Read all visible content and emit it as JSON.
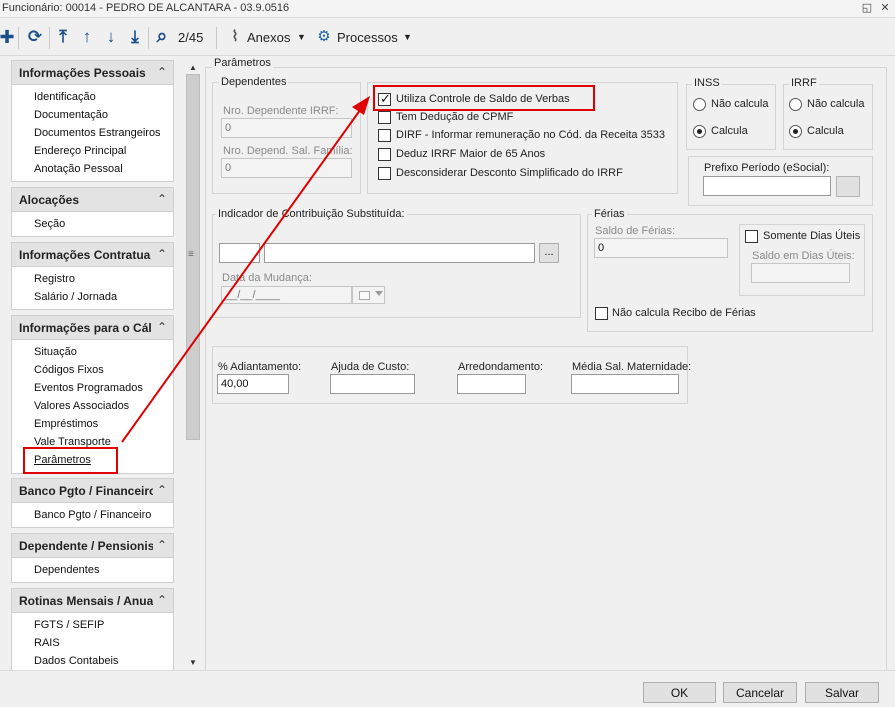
{
  "window": {
    "title": "Funcionário: 00014 - PEDRO DE ALCANTARA - 03.9.0516",
    "restore_glyph": "◱",
    "close_glyph": "✕"
  },
  "toolbar": {
    "add_icon": "plus-icon",
    "refresh_icon": "refresh-icon",
    "first_icon": "arrow-to-top-icon",
    "prev_icon": "arrow-up-icon",
    "next_icon": "arrow-down-icon",
    "last_icon": "arrow-to-bottom-icon",
    "search_icon": "search-icon",
    "record_position": "2/45",
    "attachments_label": "Anexos",
    "processes_label": "Processos",
    "glyphs": {
      "add": "✚",
      "refresh": "⟳",
      "first": "⤒",
      "prev": "↑",
      "next": "↓",
      "last": "⤓",
      "search": "⌕",
      "clip": "⌇",
      "gear": "⚙",
      "caret": "▼"
    }
  },
  "sidebar": {
    "collapse_glyph": "⌃",
    "sections": [
      {
        "title": "Informações Pessoais",
        "items": [
          "Identificação",
          "Documentação",
          "Documentos Estrangeiros",
          "Endereço Principal",
          "Anotação Pessoal"
        ]
      },
      {
        "title": "Alocações",
        "items": [
          "Seção"
        ]
      },
      {
        "title": "Informações Contratua",
        "items": [
          "Registro",
          "Salário / Jornada"
        ]
      },
      {
        "title": "Informações para o Cál",
        "items": [
          "Situação",
          "Códigos Fixos",
          "Eventos Programados",
          "Valores Associados",
          "Empréstimos",
          "Vale Transporte",
          "Parâmetros"
        ]
      },
      {
        "title": "Banco Pgto / Financeiro",
        "items": [
          "Banco Pgto / Financeiro"
        ]
      },
      {
        "title": "Dependente / Pensionis",
        "items": [
          "Dependentes"
        ]
      },
      {
        "title": "Rotinas Mensais / Anua",
        "items": [
          "FGTS / SEFIP",
          "RAIS",
          "Dados Contabeis"
        ]
      }
    ],
    "scroll_glyphs": {
      "up": "▲",
      "down": "▼",
      "grip": "≡"
    }
  },
  "main": {
    "title": "Parâmetros",
    "dependentes": {
      "legend": "Dependentes",
      "nro_irrf_label": "Nro. Dependente IRRF:",
      "nro_irrf_value": "0",
      "nro_sal_familia_label": "Nro. Depend. Sal. Família:",
      "nro_sal_familia_value": "0"
    },
    "checkboxes": [
      {
        "label": "Utiliza Controle de Saldo de Verbas",
        "checked": true
      },
      {
        "label": "Tem Dedução de CPMF",
        "checked": false
      },
      {
        "label": "DIRF - Informar remuneração no Cód. da Receita 3533",
        "checked": false
      },
      {
        "label": "Deduz IRRF Maior de 65 Anos",
        "checked": false
      },
      {
        "label": "Desconsiderar Desconto Simplificado do IRRF",
        "checked": false
      }
    ],
    "inss": {
      "legend": "INSS",
      "options": [
        "Não calcula",
        "Calcula"
      ],
      "selected": "Calcula"
    },
    "irrf": {
      "legend": "IRRF",
      "options": [
        "Não calcula",
        "Calcula"
      ],
      "selected": "Calcula"
    },
    "prefixo_periodo": {
      "label": "Prefixo Período (eSocial):",
      "value": ""
    },
    "indicador": {
      "legend": "Indicador de Contribuição Substituída:",
      "code_value": "",
      "desc_value": "",
      "lookup_label": "...",
      "data_mudanca_label": "Data da Mudança:",
      "data_mudanca_value": "__/__/____",
      "calendar_icon": "calendar-icon"
    },
    "ferias": {
      "legend": "Férias",
      "saldo_label": "Saldo de Férias:",
      "saldo_value": "0",
      "somente_dias_uteis_label": "Somente Dias Úteis",
      "saldo_dias_uteis_label": "Saldo em Dias Úteis:",
      "saldo_dias_uteis_value": "",
      "nao_calcula_recibo_label": "Não calcula Recibo de Férias"
    },
    "valores": {
      "adiantamento_label": "% Adiantamento:",
      "adiantamento_value": "40,00",
      "ajuda_custo_label": "Ajuda de Custo:",
      "ajuda_custo_value": "",
      "arredondamento_label": "Arredondamento:",
      "arredondamento_value": "",
      "media_sal_label": "Média Sal. Maternidade:",
      "media_sal_value": ""
    }
  },
  "footer": {
    "ok_label": "OK",
    "cancel_label": "Cancelar",
    "save_label": "Salvar"
  },
  "colors": {
    "highlight_red": "#e00000",
    "toolbar_blue": "#1a4f8a"
  }
}
